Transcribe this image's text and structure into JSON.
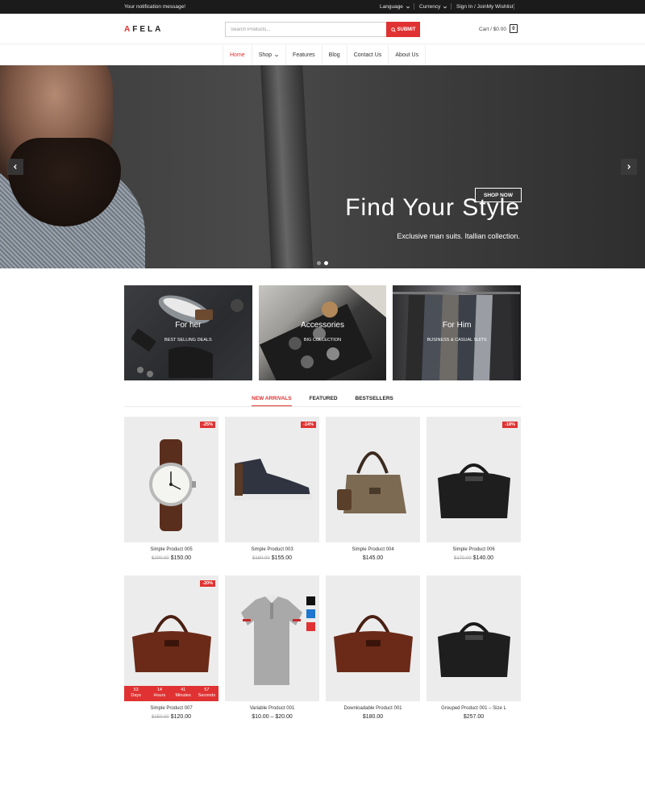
{
  "topbar": {
    "message": "Your notification message!",
    "language": "Language",
    "currency": "Currency",
    "account": "Sign In / JoinMy Wishlist"
  },
  "header": {
    "logo_first": "A",
    "logo_rest": "FELA",
    "search_placeholder": "Search Products...",
    "search_button": "SUBMIT",
    "cart_label": "Cart / $0.00",
    "cart_count": "0"
  },
  "nav": {
    "items": [
      {
        "label": "Home",
        "active": true
      },
      {
        "label": "Shop",
        "has_dropdown": true
      },
      {
        "label": "Features"
      },
      {
        "label": "Blog"
      },
      {
        "label": "Contact Us"
      },
      {
        "label": "About Us"
      }
    ]
  },
  "hero": {
    "title": "Find Your Style",
    "subtitle": "Exclusive man suits. Itallian collection.",
    "button": "SHOP NOW",
    "slides": 2,
    "active_slide": 2
  },
  "categories": [
    {
      "title": "For her",
      "subtitle": "BEST SELLING DEALS"
    },
    {
      "title": "Accessories",
      "subtitle": "BIG COLLECTION"
    },
    {
      "title": "For Him",
      "subtitle": "BUSINESS & CASUAL SUITS"
    }
  ],
  "tabs": [
    {
      "label": "NEW ARRIVALS",
      "active": true
    },
    {
      "label": "FEATURED"
    },
    {
      "label": "BESTSELLERS"
    }
  ],
  "products": [
    {
      "name": "Simple Product 005",
      "old_price": "$200.00",
      "price": "$150.00",
      "badge": "-25%",
      "image": "watch-icon"
    },
    {
      "name": "Simple Product 003",
      "old_price": "$180.00",
      "price": "$155.00",
      "badge": "-14%",
      "image": "shoe-icon"
    },
    {
      "name": "Simple Product 004",
      "old_price": "",
      "price": "$145.00",
      "badge": "",
      "image": "canvas-bag-icon"
    },
    {
      "name": "Simple Product 006",
      "old_price": "$170.00",
      "price": "$140.00",
      "badge": "-18%",
      "image": "black-bag-icon"
    },
    {
      "name": "Simple Product 007",
      "old_price": "$150.00",
      "price": "$120.00",
      "badge": "-20%",
      "image": "brown-bag-icon",
      "countdown": [
        {
          "value": "53",
          "unit": "Days"
        },
        {
          "value": "14",
          "unit": "Hours"
        },
        {
          "value": "41",
          "unit": "Minutes"
        },
        {
          "value": "57",
          "unit": "Seconds"
        }
      ]
    },
    {
      "name": "Variable Product 001",
      "old_price": "",
      "price": "$10.00 – $20.00",
      "badge": "",
      "image": "polo-shirt-icon",
      "swatches": [
        "#111111",
        "#1f77d0",
        "#e03232"
      ]
    },
    {
      "name": "Downloadable Product 001",
      "old_price": "",
      "price": "$180.00",
      "badge": "",
      "image": "brown-bag-icon"
    },
    {
      "name": "Grouped Product 001 – Size L",
      "old_price": "",
      "price": "$257.00",
      "badge": "",
      "image": "black-bag-icon"
    }
  ],
  "colors": {
    "accent": "#e03232",
    "topbar": "#1b1b1b",
    "card_bg": "#ececec"
  }
}
